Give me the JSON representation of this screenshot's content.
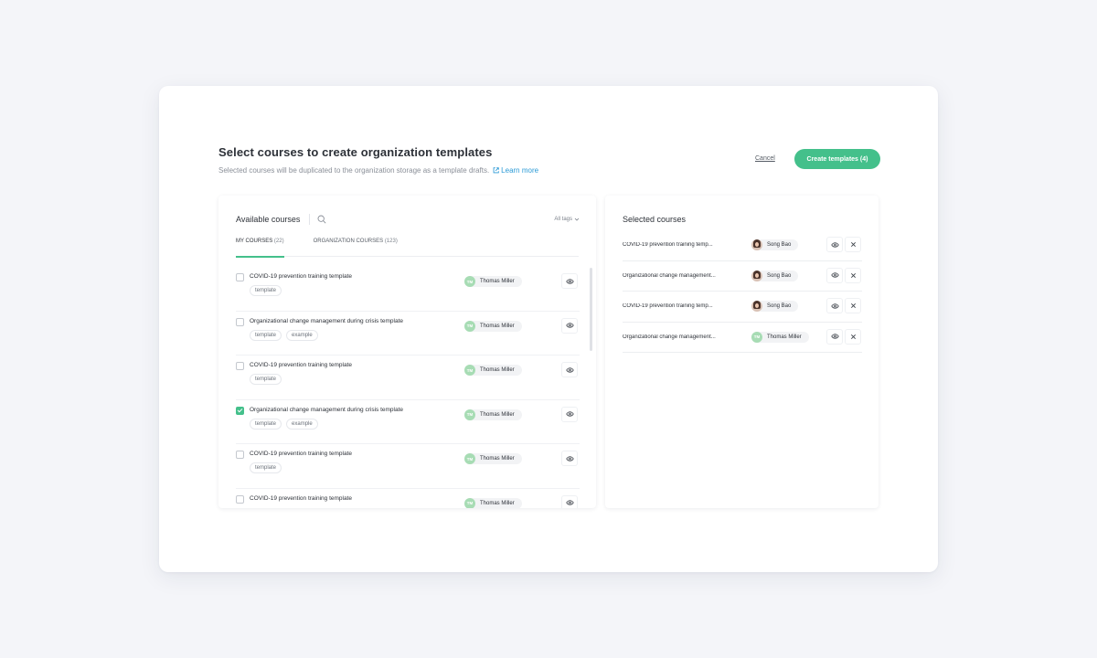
{
  "header": {
    "title": "Select courses to create organization templates",
    "subtitle": "Selected courses will be duplicated to the organization storage as a template drafts.",
    "learn_more": "Learn more",
    "cancel_label": "Cancel",
    "create_label": "Create templates (4)"
  },
  "available": {
    "title": "Available courses",
    "tags_filter": "All tags",
    "tabs": [
      {
        "label": "MY COURSES",
        "count": "(22)",
        "active": true
      },
      {
        "label": "ORGANIZATION COURSES",
        "count": "(123)",
        "active": false
      }
    ],
    "rows": [
      {
        "name": "COVID-19 prevention training template",
        "tags": [
          "template"
        ],
        "author": "Thomas Miller",
        "initials": "TM",
        "checked": false
      },
      {
        "name": "Organizational change management during crisis template",
        "tags": [
          "template",
          "example"
        ],
        "author": "Thomas Miller",
        "initials": "TM",
        "checked": false
      },
      {
        "name": "COVID-19 prevention training template",
        "tags": [
          "template"
        ],
        "author": "Thomas Miller",
        "initials": "TM",
        "checked": false
      },
      {
        "name": "Organizational change management during crisis template",
        "tags": [
          "template",
          "example"
        ],
        "author": "Thomas Miller",
        "initials": "TM",
        "checked": true
      },
      {
        "name": "COVID-19 prevention training template",
        "tags": [
          "template"
        ],
        "author": "Thomas Miller",
        "initials": "TM",
        "checked": false
      },
      {
        "name": "COVID-19 prevention training template",
        "tags": [],
        "author": "Thomas Miller",
        "initials": "TM",
        "checked": false
      }
    ]
  },
  "selected": {
    "title": "Selected courses",
    "rows": [
      {
        "name": "COVID-19 prevention training temp...",
        "author": "Song Bao",
        "avatar": "photo",
        "initials": ""
      },
      {
        "name": "Organizational change management...",
        "author": "Song Bao",
        "avatar": "photo",
        "initials": ""
      },
      {
        "name": "COVID-19 prevention training temp...",
        "author": "Song Bao",
        "avatar": "photo",
        "initials": ""
      },
      {
        "name": "Organizational change management...",
        "author": "Thomas Miller",
        "avatar": "initials",
        "initials": "TM"
      }
    ]
  },
  "colors": {
    "accent": "#44c08b",
    "link": "#2b9ad6",
    "avatar_green": "#a7dcb4"
  }
}
